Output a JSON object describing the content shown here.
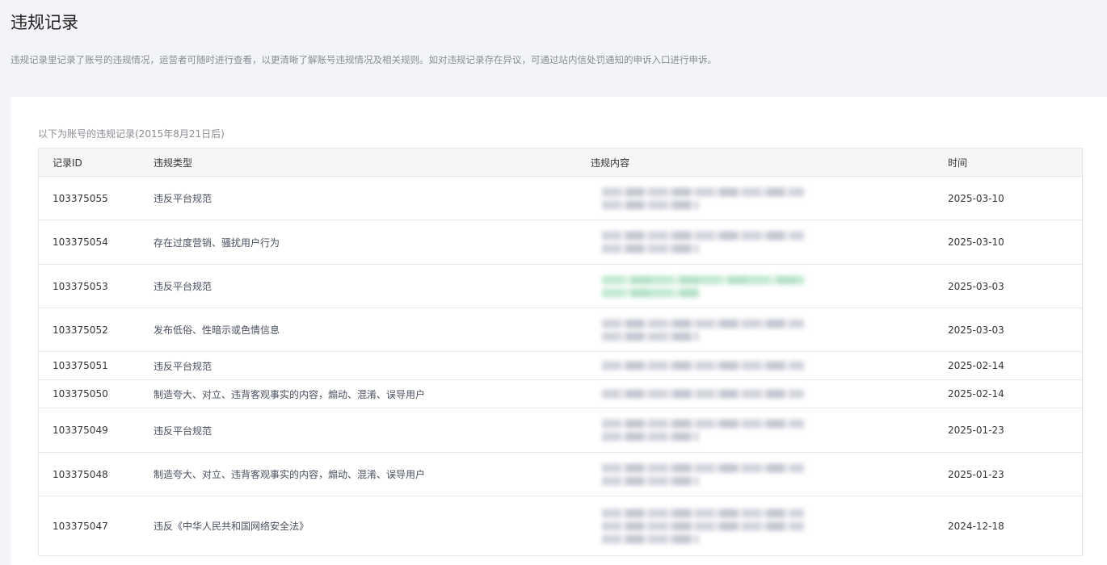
{
  "page": {
    "title": "违规记录",
    "description": "违规记录里记录了账号的违规情况，运营者可随时进行查看，以更清晰了解账号违规情况及相关规则。如对违规记录存在异议，可通过站内信处罚通知的申诉入口进行申诉。"
  },
  "table": {
    "caption": "以下为账号的违规记录(2015年8月21日后)",
    "headers": {
      "id": "记录ID",
      "type": "违规类型",
      "content": "违规内容",
      "time": "时间"
    },
    "rows": [
      {
        "id": "103375055",
        "type": "违反平台规范",
        "time": "2025-03-10",
        "content_state": "blurred"
      },
      {
        "id": "103375054",
        "type": "存在过度营销、骚扰用户行为",
        "time": "2025-03-10",
        "content_state": "blurred"
      },
      {
        "id": "103375053",
        "type": "违反平台规范",
        "time": "2025-03-03",
        "content_state": "blurred-green"
      },
      {
        "id": "103375052",
        "type": "发布低俗、性暗示或色情信息",
        "time": "2025-03-03",
        "content_state": "blurred"
      },
      {
        "id": "103375051",
        "type": "违反平台规范",
        "time": "2025-02-14",
        "content_state": "blurred"
      },
      {
        "id": "103375050",
        "type": "制造夸大、对立、违背客观事实的内容，煽动、混淆、误导用户",
        "time": "2025-02-14",
        "content_state": "blurred"
      },
      {
        "id": "103375049",
        "type": "违反平台规范",
        "time": "2025-01-23",
        "content_state": "blurred"
      },
      {
        "id": "103375048",
        "type": "制造夸大、对立、违背客观事实的内容，煽动、混淆、误导用户",
        "time": "2025-01-23",
        "content_state": "blurred"
      },
      {
        "id": "103375047",
        "type": "违反《中华人民共和国网络安全法》",
        "time": "2024-12-18",
        "content_state": "blurred"
      }
    ]
  }
}
